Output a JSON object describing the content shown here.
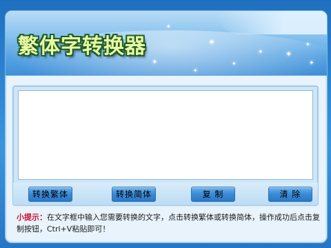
{
  "app": {
    "title": "繁体字转换器"
  },
  "editor": {
    "value": "",
    "placeholder": ""
  },
  "buttons": {
    "to_traditional": "转换繁体",
    "to_simplified": "转换简体",
    "copy": "复 制",
    "clear": "清 除"
  },
  "tip": {
    "label": "小提示：",
    "text": "在文字框中输入您需要转换的文字，点击转换繁体或转换简体，操作成功后点击复制按钮，Ctrl+V粘贴即可！"
  },
  "colors": {
    "title_fill": "#eaf9a0",
    "title_outline": "#1d5d2a",
    "tip_label": "#c8102e",
    "button_blue": "#3a8ad6"
  },
  "icons": {
    "sparkle": "✦"
  }
}
